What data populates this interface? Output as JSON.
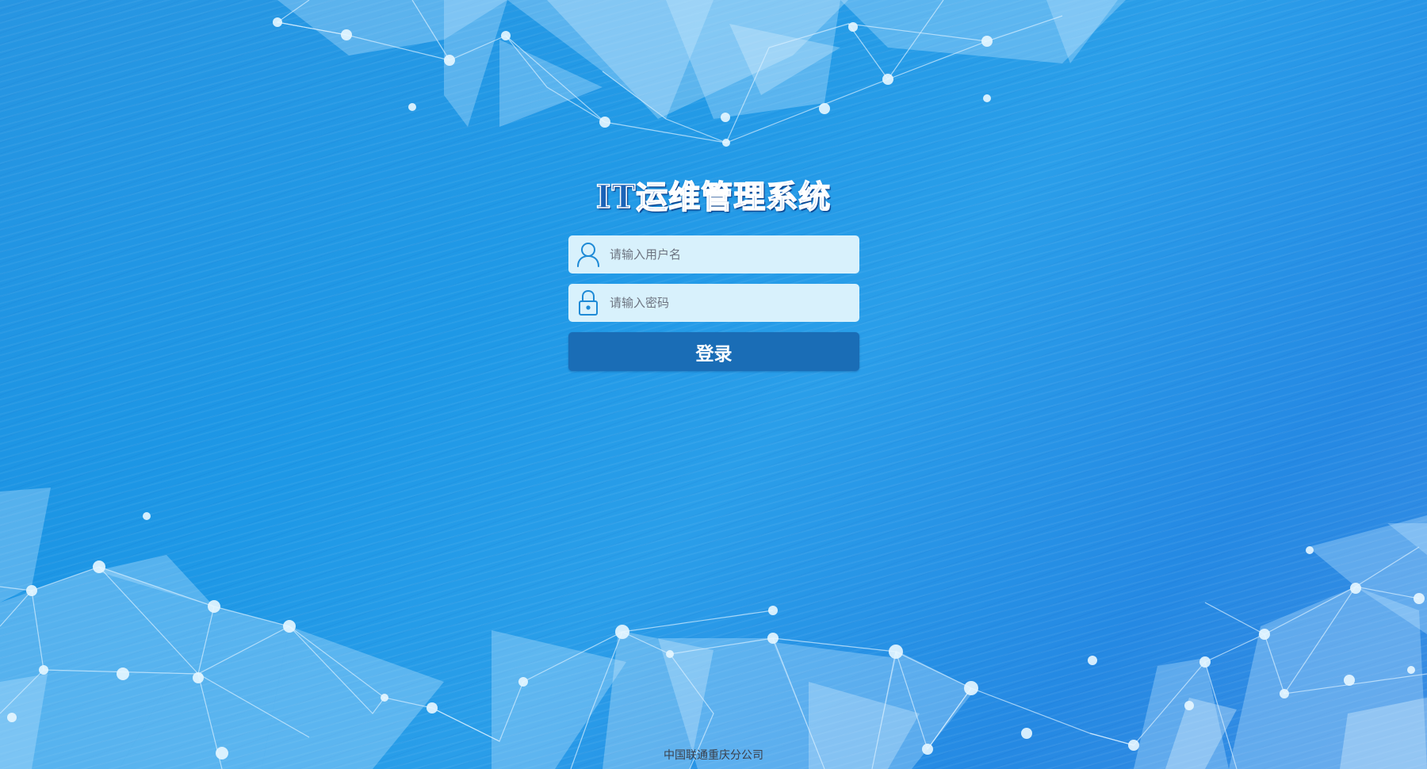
{
  "app": {
    "title": "IT运维管理系统"
  },
  "login_form": {
    "username": {
      "placeholder": "请输入用户名",
      "icon": "user-icon"
    },
    "password": {
      "placeholder": "请输入密码",
      "icon": "lock-icon"
    },
    "login_label": "登录"
  },
  "footer": {
    "company": "中国联通重庆分公司"
  },
  "colors": {
    "background": "#1e98e6",
    "input_background": "#d8f1fc",
    "button": "#1a6db6",
    "icon_stroke": "#1e8ad6",
    "title_fill": "#1b63b8"
  }
}
